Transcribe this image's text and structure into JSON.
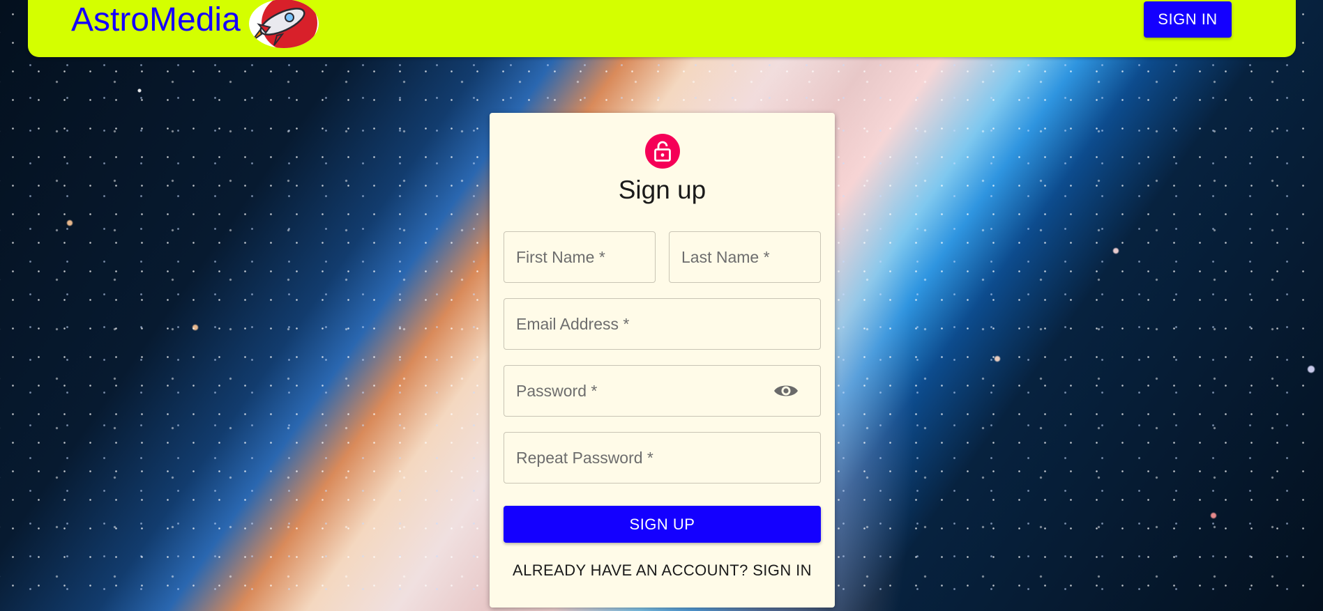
{
  "header": {
    "brand": "AstroMedia",
    "logo_icon": "rocket-logo-icon",
    "sign_in_label": "SIGN IN",
    "bar_color": "#d4ff00",
    "brand_color": "#1500ff"
  },
  "form": {
    "icon": "lock-open-icon",
    "title": "Sign up",
    "fields": {
      "first_name": "First Name *",
      "last_name": "Last Name *",
      "email": "Email Address *",
      "password": "Password *",
      "repeat_password": "Repeat Password *"
    },
    "password_toggle_icon": "eye-icon",
    "submit_label": "SIGN UP",
    "signin_link": "ALREADY HAVE AN ACCOUNT? SIGN IN",
    "button_color": "#1400ff",
    "avatar_color": "#f50057",
    "card_color": "#fffbe8"
  }
}
